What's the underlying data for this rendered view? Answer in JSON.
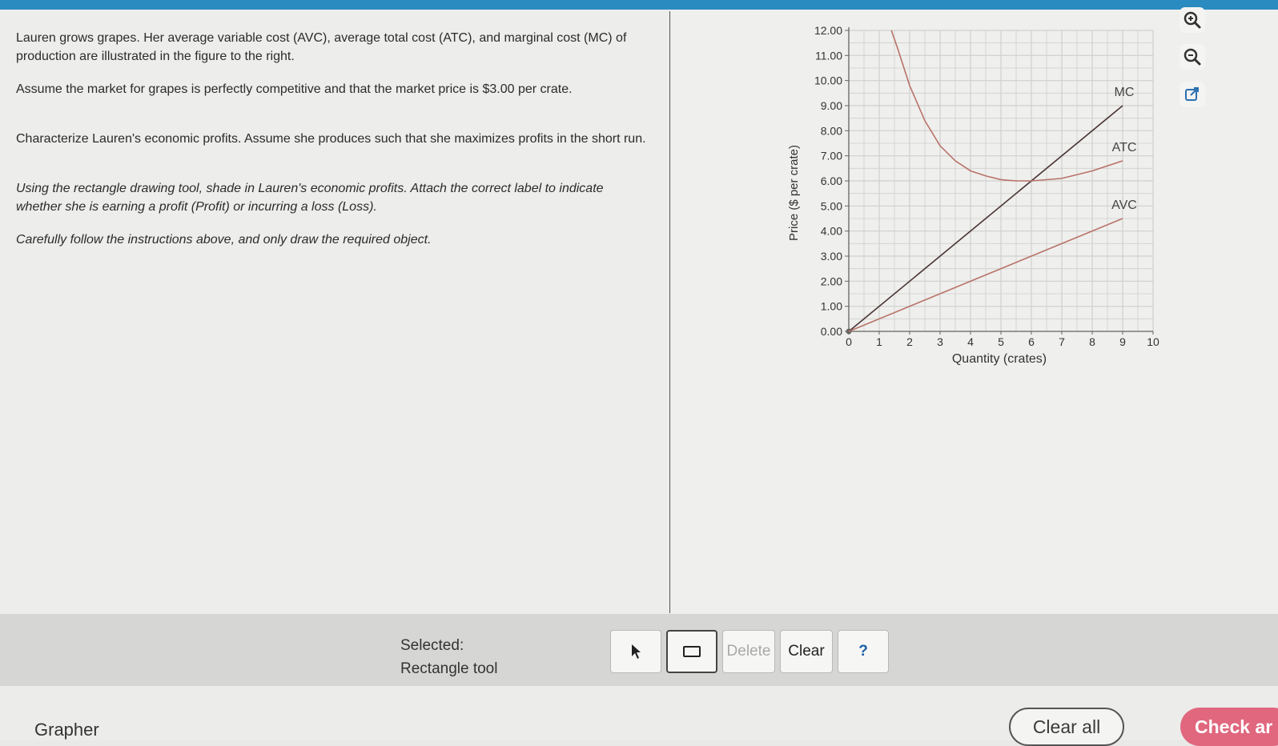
{
  "problem": {
    "p1": "Lauren grows grapes. Her average variable cost (AVC), average total cost (ATC), and marginal cost (MC) of production are illustrated in the figure to the right.",
    "p2": "Assume the market for grapes is perfectly competitive and that the market price is $3.00 per crate.",
    "p3": "Characterize Lauren's economic profits. Assume she produces such that she maximizes profits in the short run.",
    "p4": "Using the rectangle drawing tool, shade in Lauren's economic profits. Attach the correct label to indicate whether she is earning a profit (Profit) or incurring a loss (Loss).",
    "p5": "Carefully follow the instructions above, and only draw the required object."
  },
  "chart_data": {
    "type": "line",
    "xlabel": "Quantity (crates)",
    "ylabel": "Price ($ per crate)",
    "xlim": [
      0,
      10
    ],
    "ylim": [
      0,
      12
    ],
    "x_ticks": [
      "0",
      "1",
      "2",
      "3",
      "4",
      "5",
      "6",
      "7",
      "8",
      "9",
      "10"
    ],
    "y_ticks": [
      "0.00",
      "1.00",
      "2.00",
      "3.00",
      "4.00",
      "5.00",
      "6.00",
      "7.00",
      "8.00",
      "9.00",
      "10.00",
      "11.00",
      "12.00"
    ],
    "grid": true,
    "series": [
      {
        "name": "MC",
        "color": "#4a3535",
        "x": [
          0,
          9
        ],
        "y": [
          0,
          9
        ]
      },
      {
        "name": "ATC",
        "color": "#b87368",
        "x": [
          1.4,
          1.6,
          2,
          2.5,
          3,
          3.5,
          4,
          4.5,
          5,
          5.5,
          6,
          7,
          8,
          9
        ],
        "y": [
          12,
          11.3,
          9.8,
          8.4,
          7.4,
          6.8,
          6.4,
          6.2,
          6.05,
          6.0,
          6.0,
          6.1,
          6.4,
          6.8
        ]
      },
      {
        "name": "AVC",
        "color": "#b87368",
        "x": [
          0,
          9
        ],
        "y": [
          0,
          4.5
        ]
      }
    ]
  },
  "side_tools": {
    "zoom_in": "zoom-in-icon",
    "zoom_out": "zoom-out-icon",
    "popout": "popout-icon"
  },
  "toolbar": {
    "selected_label": "Selected:",
    "selected_tool": "Rectangle tool",
    "delete": "Delete",
    "clear": "Clear",
    "help": "?"
  },
  "footer": {
    "grapher": "Grapher",
    "clear_all": "Clear all",
    "check": "Check ar"
  }
}
